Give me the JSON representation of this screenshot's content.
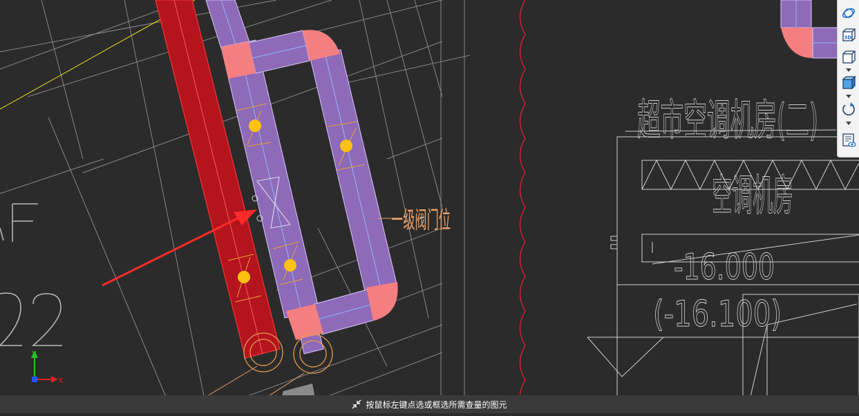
{
  "drawing": {
    "valve_label": "一级阀门位",
    "room_title": "超市空调机房(二)",
    "room_name": "空调机房",
    "elevation": "-16.000",
    "elevation_alt": "(-16.100)",
    "axis_left_letter": "F",
    "axis_left_number": "22"
  },
  "axes": {
    "x_label": "X",
    "y_label": "Y"
  },
  "colors": {
    "background": "#2b2b2b",
    "duct": "#8e6ab8",
    "duct_fitting": "#f47f80",
    "red_beam": "#b3141e",
    "valve_dot": "#ffc20e",
    "annotation": "#e8a06a",
    "linework": "#c8c8c8"
  },
  "toolbar": {
    "tools": [
      {
        "name": "orbit-icon"
      },
      {
        "name": "3d-view-icon",
        "label": "3D"
      },
      {
        "name": "box-view-icon"
      },
      {
        "name": "cube-view-icon"
      },
      {
        "name": "rotate-icon"
      },
      {
        "name": "properties-view-icon"
      }
    ]
  },
  "status": {
    "message": "按鼠标左键点选或框选所需查量的图元"
  }
}
